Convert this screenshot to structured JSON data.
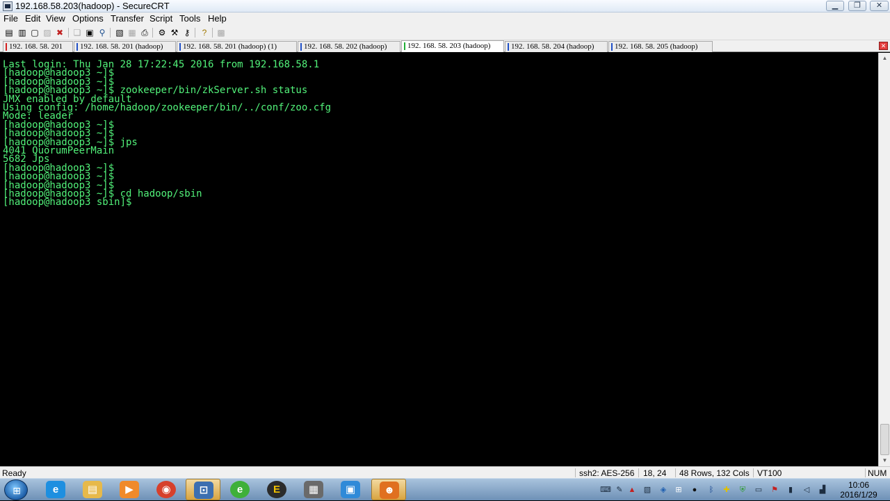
{
  "window": {
    "title": "192.168.58.203(hadoop) - SecureCRT",
    "controls": {
      "minimize": "▁",
      "maximize": "❐",
      "close": "✕"
    }
  },
  "menu": [
    "File",
    "Edit",
    "View",
    "Options",
    "Transfer",
    "Script",
    "Tools",
    "Help"
  ],
  "toolbar": {
    "icons": [
      "connect-icon",
      "quick-connect-icon",
      "connect-in-tab-icon",
      "reconnect-icon",
      "disconnect-icon",
      "copy-icon",
      "paste-icon",
      "find-icon",
      "print-setup-icon",
      "print-selection-icon",
      "print-icon",
      "session-options-icon",
      "global-options-icon",
      "keymap-icon",
      "help-icon",
      "sftp-icon"
    ]
  },
  "tabs": [
    {
      "label": "192. 168. 58. 201",
      "color": "#d42020",
      "active": false
    },
    {
      "label": "192. 168. 58. 201 (hadoop)",
      "color": "#2050c8",
      "active": false
    },
    {
      "label": "192. 168. 58. 201 (hadoop)   (1)",
      "color": "#2050c8",
      "active": false
    },
    {
      "label": "192. 168. 58. 202 (hadoop)",
      "color": "#2050c8",
      "active": false
    },
    {
      "label": "192. 168. 58. 203 (hadoop)",
      "color": "#1fae34",
      "active": true
    },
    {
      "label": "192. 168. 58. 204 (hadoop)",
      "color": "#2050c8",
      "active": false
    },
    {
      "label": "192. 168. 58. 205 (hadoop)",
      "color": "#2050c8",
      "active": false
    }
  ],
  "tab_close": "✕",
  "terminal": {
    "text_color": "#52f27a",
    "background": "#000000",
    "lines": [
      "Last login: Thu Jan 28 17:22:45 2016 from 192.168.58.1",
      "[hadoop@hadoop3 ~]$",
      "[hadoop@hadoop3 ~]$",
      "[hadoop@hadoop3 ~]$ zookeeper/bin/zkServer.sh status",
      "JMX enabled by default",
      "Using config: /home/hadoop/zookeeper/bin/../conf/zoo.cfg",
      "Mode: leader",
      "[hadoop@hadoop3 ~]$",
      "[hadoop@hadoop3 ~]$",
      "[hadoop@hadoop3 ~]$ jps",
      "4041 QuorumPeerMain",
      "5682 Jps",
      "[hadoop@hadoop3 ~]$",
      "[hadoop@hadoop3 ~]$",
      "[hadoop@hadoop3 ~]$",
      "[hadoop@hadoop3 ~]$ cd hadoop/sbin",
      "[hadoop@hadoop3 sbin]$"
    ]
  },
  "scrollbar": {
    "up": "▲",
    "down": "▼"
  },
  "status": {
    "ready": "Ready",
    "protocol": "ssh2: AES-256",
    "cursor": "18,  24",
    "size": "48 Rows, 132 Cols",
    "emulation": "VT100",
    "numlock": "NUM"
  },
  "taskbar": {
    "start_glyph": "⊞",
    "apps": [
      {
        "name": "ie-icon",
        "glyph": "e",
        "color": "#1e8fe0"
      },
      {
        "name": "file-explorer-icon",
        "glyph": "▤",
        "color": "#e7b94a"
      },
      {
        "name": "media-player-icon",
        "glyph": "▶",
        "color": "#f08a2a"
      },
      {
        "name": "chrome-icon",
        "glyph": "◉",
        "color": "#d6402c"
      },
      {
        "name": "vpn-client-icon",
        "glyph": "⊡",
        "color": "#3d6fb0"
      },
      {
        "name": "browser-360-icon",
        "glyph": "e",
        "color": "#3fb03a"
      },
      {
        "name": "everything-search-icon",
        "glyph": "E",
        "color": "#2b2b2b"
      },
      {
        "name": "virtualbox-icon",
        "glyph": "▦",
        "color": "#6a6a6a"
      },
      {
        "name": "remote-desktop-icon",
        "glyph": "▣",
        "color": "#2f8ad8"
      },
      {
        "name": "securecrt-icon",
        "glyph": "☻",
        "color": "#e07020"
      }
    ],
    "tray_icons": [
      {
        "name": "keyboard-icon",
        "glyph": "⌨"
      },
      {
        "name": "pen-icon",
        "glyph": "✎"
      },
      {
        "name": "security-icon",
        "glyph": "▲"
      },
      {
        "name": "printer-icon",
        "glyph": "▧"
      },
      {
        "name": "shield-icon",
        "glyph": "◈"
      },
      {
        "name": "windows-flag-icon",
        "glyph": "⊞"
      },
      {
        "name": "qq-icon",
        "glyph": "●"
      },
      {
        "name": "bluetooth-icon",
        "glyph": "ᛒ"
      },
      {
        "name": "network-plus-icon",
        "glyph": "✚"
      },
      {
        "name": "antivirus-icon",
        "glyph": "⛨"
      },
      {
        "name": "display-icon",
        "glyph": "▭"
      },
      {
        "name": "flag-icon",
        "glyph": "⚑"
      },
      {
        "name": "power-icon",
        "glyph": "▮"
      },
      {
        "name": "volume-icon",
        "glyph": "◁"
      },
      {
        "name": "signal-icon",
        "glyph": "▟"
      }
    ],
    "time": "10:06",
    "date": "2016/1/29"
  }
}
